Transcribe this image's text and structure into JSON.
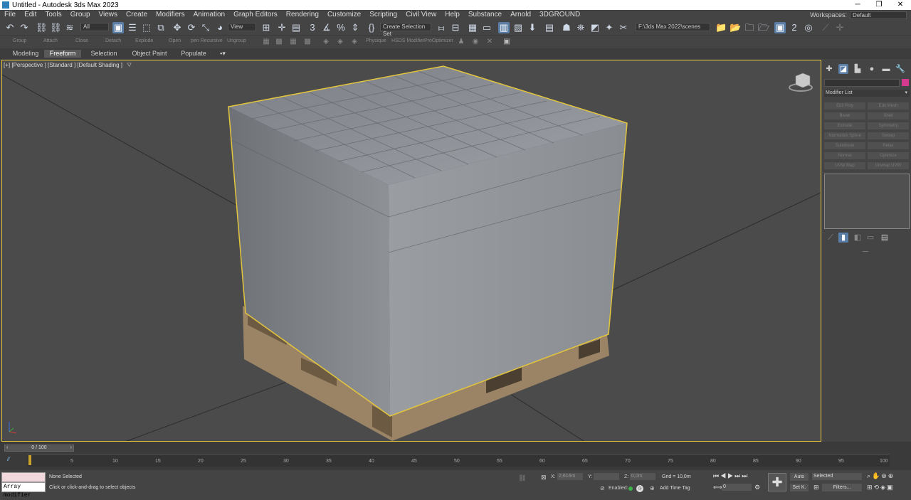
{
  "window": {
    "title": "Untitled - Autodesk 3ds Max 2023",
    "min": "─",
    "max": "❐",
    "close": "✕"
  },
  "menu": [
    "File",
    "Edit",
    "Tools",
    "Group",
    "Views",
    "Create",
    "Modifiers",
    "Animation",
    "Graph Editors",
    "Rendering",
    "Customize",
    "Scripting",
    "Civil View",
    "Help",
    "Substance",
    "Arnold",
    "3DGROUND"
  ],
  "workspace": {
    "label": "Workspaces:",
    "value": "Default"
  },
  "toolbar": {
    "filter_value": "All",
    "refcoord_value": "View",
    "selection_set_value": "Create Selection Set",
    "project_path": "F:\\3ds Max 2022\\scenes",
    "snap_value": "3",
    "angle_snap_value": "2"
  },
  "ribbon_tools": [
    "Group",
    "Attach",
    "Close",
    "Detach",
    "Explode",
    "Open",
    "pen Recursive",
    "Ungroup",
    "Physique",
    "HSDS Modifier",
    "ProOptimizer"
  ],
  "ribbon_tabs": [
    "Modeling",
    "Freeform",
    "Selection",
    "Object Paint",
    "Populate"
  ],
  "viewport": {
    "label": "[+] [Perspective ] [Standard ] [Default Shading ]"
  },
  "command_panel": {
    "modifier_list_label": "Modifier List",
    "buttons": [
      "Edit Poly",
      "Edit Mesh",
      "Bevel",
      "Shell",
      "Extrude",
      "Symmetry",
      "Normalize Spline",
      "Sweep",
      "Subdivide",
      "Relax",
      "Normal",
      "Optimize",
      "UVW Map",
      "Unwrap UVW"
    ]
  },
  "timeline": {
    "frame_display": "0 / 100",
    "ticks": [
      "5",
      "10",
      "15",
      "20",
      "25",
      "30",
      "35",
      "40",
      "45",
      "50",
      "55",
      "60",
      "65",
      "70",
      "75",
      "80",
      "85",
      "90",
      "95",
      "100"
    ]
  },
  "status": {
    "maxscript_listener": "Array modifier",
    "selection_status": "None Selected",
    "prompt": "Click or click-and-drag to select objects",
    "x_label": "X:",
    "x_value": "2,616m",
    "y_label": "Y:",
    "y_value": "",
    "z_label": "Z:",
    "z_value": "0,0m",
    "grid": "Grid = 10,0m",
    "enabled_label": "Enabled:",
    "add_time_tag": "Add Time Tag",
    "auto_key": "Auto",
    "set_key": "Set K.",
    "selected_value": "Selected",
    "filters": "Filters...",
    "frame_value": "0"
  },
  "colors": {
    "accent": "#5b7ea6",
    "selection_outline": "#e3c53d",
    "viewport_bg": "#4b4b4b"
  }
}
